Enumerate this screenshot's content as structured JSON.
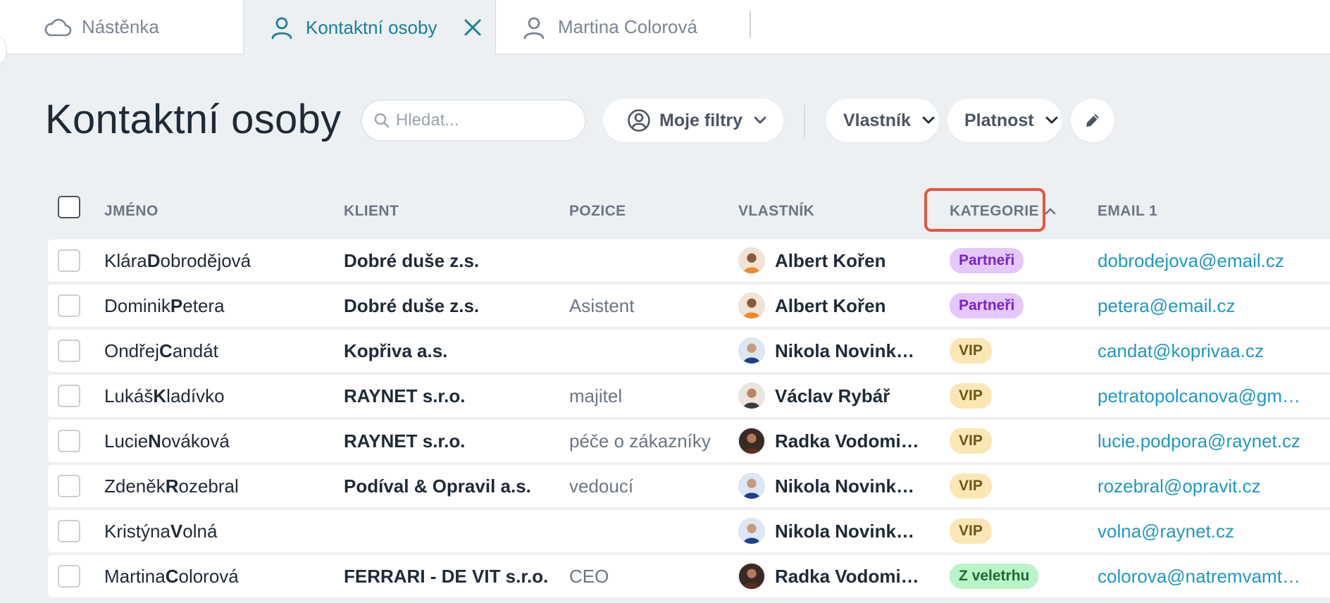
{
  "tabs": [
    {
      "label": "Nástěnka",
      "icon": "cloud-icon"
    },
    {
      "label": "Kontaktní osoby",
      "icon": "user-icon",
      "active": true
    },
    {
      "label": "Martina Colorová",
      "icon": "user-icon"
    }
  ],
  "header": {
    "title": "Kontaktní osoby",
    "search_placeholder": "Hledat...",
    "my_filters_label": "Moje filtry",
    "owner_filter_label": "Vlastník",
    "validity_filter_label": "Platnost"
  },
  "table": {
    "columns": {
      "name": "JMÉNO",
      "client": "KLIENT",
      "position": "POZICE",
      "owner": "VLASTNÍK",
      "category": "KATEGORIE",
      "email": "EMAIL 1"
    },
    "sorted_by": "category",
    "sort_direction": "ascending",
    "rows": [
      {
        "first": "Klára ",
        "last_initial": "D",
        "last_rest": "obrodějová",
        "client": "Dobré duše z.s.",
        "position": "",
        "owner": "Albert Kořen",
        "category": "Partneři",
        "email": "dobrodejova@email.cz"
      },
      {
        "first": "Dominik ",
        "last_initial": "P",
        "last_rest": "etera",
        "client": "Dobré duše z.s.",
        "position": "Asistent",
        "owner": "Albert Kořen",
        "category": "Partneři",
        "email": "petera@email.cz"
      },
      {
        "first": "Ondřej ",
        "last_initial": "C",
        "last_rest": "andát",
        "client": "Kopřiva a.s.",
        "position": "",
        "owner": "Nikola Novinková",
        "category": "VIP",
        "email": "candat@koprivaa.cz"
      },
      {
        "first": "Lukáš ",
        "last_initial": "K",
        "last_rest": "ladívko",
        "client": "RAYNET s.r.o.",
        "position": "majitel",
        "owner": "Václav Rybář",
        "category": "VIP",
        "email": "petratopolcanova@gma…"
      },
      {
        "first": "Lucie ",
        "last_initial": "N",
        "last_rest": "ováková",
        "client": "RAYNET s.r.o.",
        "position": "péče o zákazníky",
        "owner": "Radka Vodomil…",
        "category": "VIP",
        "email": "lucie.podpora@raynet.cz"
      },
      {
        "first": "Zdeněk ",
        "last_initial": "R",
        "last_rest": "ozebral",
        "client": "Podíval & Opravil a.s.",
        "position": "vedoucí",
        "owner": "Nikola Novinková",
        "category": "VIP",
        "email": "rozebral@opravit.cz"
      },
      {
        "first": "Kristýna ",
        "last_initial": "V",
        "last_rest": "olná",
        "client": "",
        "position": "",
        "owner": "Nikola Novinková",
        "category": "VIP",
        "email": "volna@raynet.cz"
      },
      {
        "first": "Martina ",
        "last_initial": "C",
        "last_rest": "olorová",
        "client": "FERRARI - DE VIT s.r.o.",
        "position": "CEO",
        "owner": "Radka Vodomil…",
        "category": "Z veletrhu",
        "email": "colorova@natremvamto…"
      }
    ]
  },
  "category_colors": {
    "Partneři": {
      "bg": "#e4c8fb",
      "fg": "#7a25c4"
    },
    "VIP": {
      "bg": "#fae7b4",
      "fg": "#6e5518"
    },
    "Z veletrhu": {
      "bg": "#b9f3c6",
      "fg": "#1d6b33"
    }
  },
  "accent_color": "#1a7f9c",
  "sort_highlight_color": "#e6553f"
}
